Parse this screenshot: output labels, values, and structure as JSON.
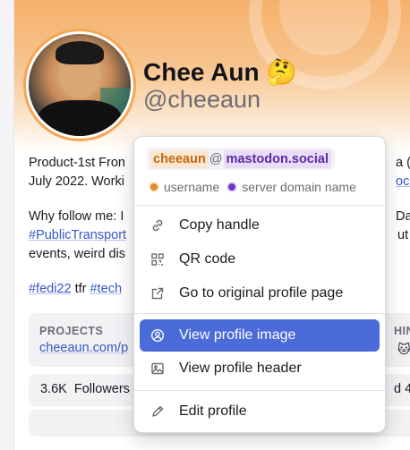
{
  "profile": {
    "display_name": "Chee Aun",
    "emoji": "🤔",
    "handle": "@cheeaun",
    "bio_line1_start": "Product-1st Fron",
    "bio_line1_end": "a (l",
    "bio_line2_start": "July 2022. Worki",
    "bio_line2_link": "ocial",
    "bio_line3_start": "Why follow me: I",
    "bio_line3_end": "Data",
    "bio_line4_tag": "#PublicTransport",
    "bio_line4_end": "ut m",
    "bio_line5": "events, weird dis",
    "bio_line6_tag1": "#fedi22",
    "bio_line6_mid": " tfr ",
    "bio_line6_tag2": "#tech"
  },
  "fields": {
    "label": "PROJECTS",
    "value": "cheeaun.com/p",
    "label_right": "HINK",
    "value_right": "🐱 ["
  },
  "stats": {
    "followers_count": "3.6K",
    "followers_label": "Followers",
    "right_text": "d 4"
  },
  "menu": {
    "username": "cheeaun",
    "at": "@",
    "server": "mastodon.social",
    "legend_username": "username",
    "legend_server": "server domain name",
    "items": [
      {
        "label": "Copy handle",
        "icon": "link-icon"
      },
      {
        "label": "QR code",
        "icon": "qr-code-icon"
      },
      {
        "label": "Go to original profile page",
        "icon": "external-link-icon"
      },
      {
        "label": "View profile image",
        "icon": "user-circle-icon"
      },
      {
        "label": "View profile header",
        "icon": "image-icon"
      },
      {
        "label": "Edit profile",
        "icon": "pencil-icon"
      }
    ]
  },
  "colors": {
    "accent": "#4a6bd8",
    "username": "#c06a10",
    "server": "#5a2aa8",
    "link": "#3457c7"
  }
}
